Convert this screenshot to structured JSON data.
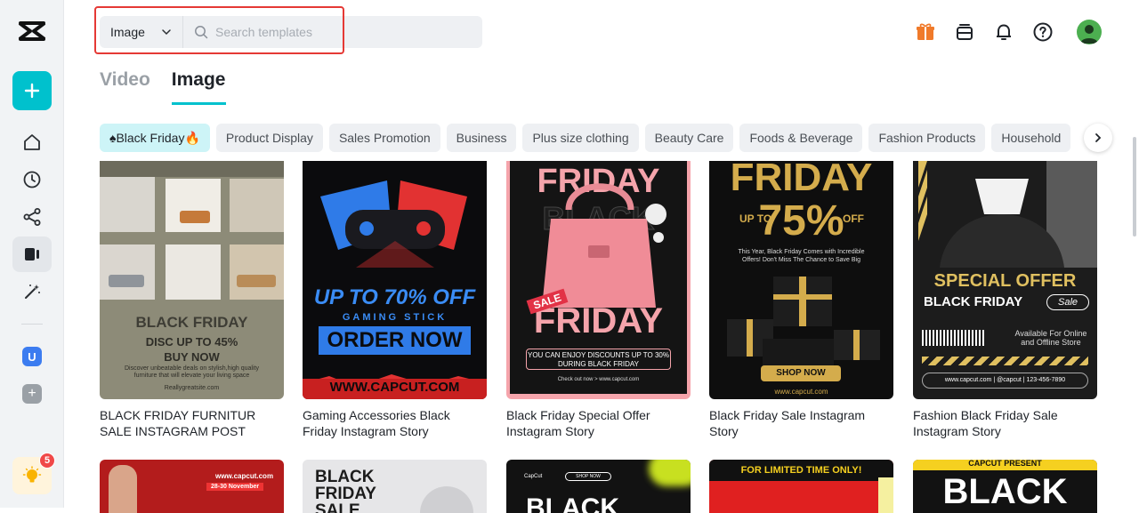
{
  "search": {
    "type_value": "Image",
    "placeholder": "Search templates"
  },
  "tabs": [
    {
      "label": "Video",
      "active": false
    },
    {
      "label": "Image",
      "active": true
    }
  ],
  "categories": [
    {
      "label": "♠Black Friday🔥",
      "active": true
    },
    {
      "label": "Product Display"
    },
    {
      "label": "Sales Promotion"
    },
    {
      "label": "Business"
    },
    {
      "label": "Plus size clothing"
    },
    {
      "label": "Beauty Care"
    },
    {
      "label": "Foods & Beverage"
    },
    {
      "label": "Fashion Products"
    },
    {
      "label": "Household"
    }
  ],
  "sidebar": {
    "space_letter": "U",
    "tip_badge": "5"
  },
  "colors": {
    "accent": "#00c1cd",
    "active_chip": "#cdf4f7",
    "highlight": "#e53935",
    "badge": "#f04848"
  },
  "templates": [
    {
      "title": "BLACK FRIDAY FURNITUR SALE INSTAGRAM POST",
      "thumb": {
        "h1": "BLACK FRIDAY",
        "h2": "DISC UP TO 45%",
        "h3": "BUY NOW",
        "body": "Discover unbeatable deals on stylish,high quality furniture that will elevate your living space",
        "foot": "Reallygreatsite.com"
      }
    },
    {
      "title": "Gaming Accessories Black Friday Instagram Story",
      "thumb": {
        "h1": "UP TO 70% OFF",
        "h2": "GAMING STICK",
        "h3": "ORDER NOW",
        "foot": "WWW.CAPCUT.COM"
      }
    },
    {
      "title": "Black Friday Special Offer Instagram Story",
      "thumb": {
        "h1": "FRIDAY",
        "h2": "BLACK",
        "badge": "SALE",
        "h3": "FRIDAY",
        "body": "YOU CAN ENJOY DISCOUNTS UP TO 30% DURING BLACK FRIDAY",
        "foot": "Check out now > www.capcut.com"
      }
    },
    {
      "title": "Black Friday Sale Instagram Story",
      "thumb": {
        "h1": "FRIDAY",
        "h2": "UP TO",
        "h3": "75%",
        "h4": "OFF",
        "body": "This Year, Black Friday Comes with Incredible Offers! Don't Miss The Chance to Save Big",
        "cta": "SHOP NOW",
        "foot": "www.capcut.com"
      }
    },
    {
      "title": "Fashion Black Friday Sale Instagram Story",
      "thumb": {
        "h1": "SPECIAL OFFER",
        "h2": "BLACK FRIDAY",
        "badge": "Sale",
        "body": "Available For Online and Offline Store",
        "foot": "www.capcut.com | @capcut | 123-456-7890"
      }
    }
  ],
  "row2": [
    {
      "l1": "www.capcut.com",
      "l2": "28-30 November"
    },
    {
      "l1": "BLACK",
      "l2": "FRIDAY",
      "l3": "SALE"
    },
    {
      "l1": "CapCut",
      "l2": "SHOP NOW",
      "l3": "BLACK"
    },
    {
      "l1": "FOR LIMITED TIME ONLY!"
    },
    {
      "l1": "CAPCUT PRESENT",
      "l2": "BLACK"
    }
  ]
}
